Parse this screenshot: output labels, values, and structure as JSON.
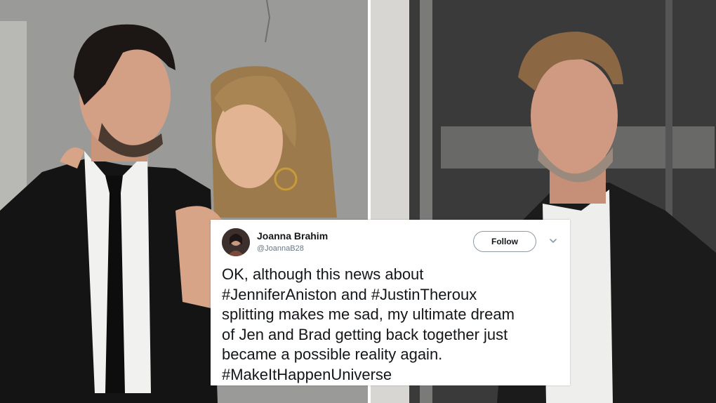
{
  "tweet": {
    "display_name": "Joanna Brahim",
    "handle": "@JoannaB28",
    "follow_label": "Follow",
    "text_lines": [
      "OK, although this news about",
      "#JenniferAniston and #JustinTheroux",
      "splitting makes me sad, my ultimate dream",
      "of Jen and Brad getting back together just",
      "became a possible reality again.",
      "#MakeItHappenUniverse"
    ]
  },
  "icons": {
    "menu": "chevron-down-icon",
    "avatar": "user-avatar"
  },
  "colors": {
    "name": "#14171a",
    "handle": "#657786",
    "follow_border": "#8c9aa6"
  }
}
